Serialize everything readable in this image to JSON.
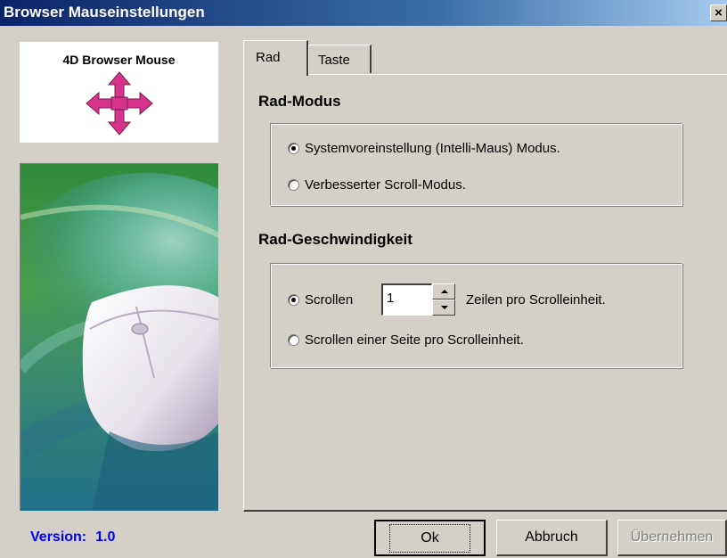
{
  "window": {
    "title": "Browser Mauseinstellungen",
    "close_glyph": "×"
  },
  "logo": {
    "title": "4D Browser Mouse",
    "icon": "four-way-arrow-icon",
    "color": "#d6338c"
  },
  "version": {
    "label": "Version:",
    "value": "1.0"
  },
  "tabs": [
    {
      "label": "Rad",
      "selected": true
    },
    {
      "label": "Taste",
      "selected": false
    }
  ],
  "wheel_mode": {
    "title": "Rad-Modus",
    "options": [
      {
        "label": "Systemvoreinstellung (Intelli-Maus) Modus.",
        "checked": true
      },
      {
        "label": "Verbesserter Scroll-Modus.",
        "checked": false
      }
    ]
  },
  "wheel_speed": {
    "title": "Rad-Geschwindigkeit",
    "scroll_label": "Scrollen",
    "lines_value": "1",
    "lines_suffix": "Zeilen pro Scrolleinheit.",
    "page_option": "Scrollen einer Seite pro Scrolleinheit.",
    "lines_checked": true
  },
  "buttons": {
    "ok": "Ok",
    "cancel": "Abbruch",
    "apply": "Übernehmen"
  }
}
